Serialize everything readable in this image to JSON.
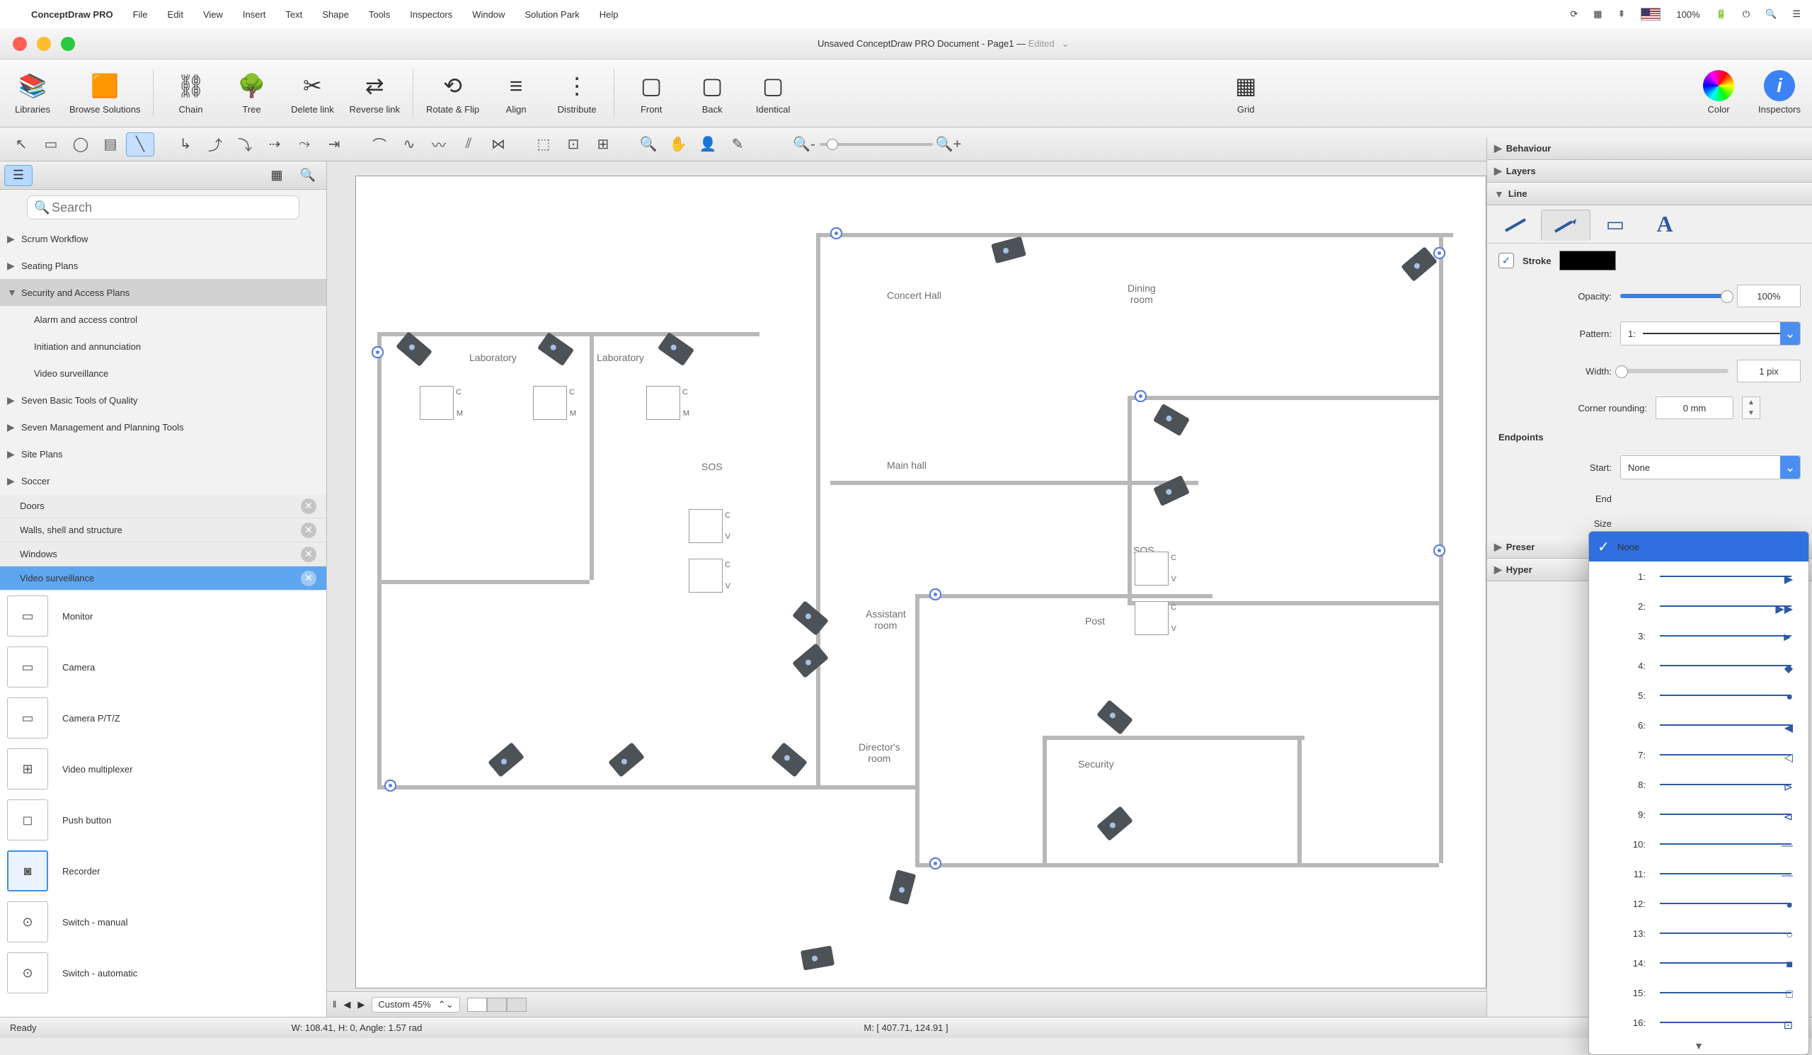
{
  "mac": {
    "app": "ConceptDraw PRO",
    "menu": [
      "File",
      "Edit",
      "View",
      "Insert",
      "Text",
      "Shape",
      "Tools",
      "Inspectors",
      "Window",
      "Solution Park",
      "Help"
    ],
    "battery": "100%"
  },
  "title": {
    "doc": "Unsaved ConceptDraw PRO Document - Page1",
    "edited": "Edited"
  },
  "toolbar": {
    "libraries": "Libraries",
    "browse": "Browse Solutions",
    "chain": "Chain",
    "tree": "Tree",
    "delete_link": "Delete link",
    "reverse_link": "Reverse link",
    "rotate": "Rotate & Flip",
    "align": "Align",
    "distribute": "Distribute",
    "front": "Front",
    "back": "Back",
    "identical": "Identical",
    "grid": "Grid",
    "color": "Color",
    "inspectors": "Inspectors"
  },
  "left": {
    "search_placeholder": "Search",
    "tree": [
      {
        "t": "Scrum Workflow",
        "exp": false
      },
      {
        "t": "Seating Plans",
        "exp": false
      },
      {
        "t": "Security and Access Plans",
        "exp": true,
        "sel": true
      },
      {
        "t": "Alarm and access control",
        "sub": true
      },
      {
        "t": "Initiation and annunciation",
        "sub": true
      },
      {
        "t": "Video surveillance",
        "sub": true
      },
      {
        "t": "Seven Basic Tools of Quality",
        "exp": false
      },
      {
        "t": "Seven Management and Planning Tools",
        "exp": false
      },
      {
        "t": "Site Plans",
        "exp": false
      },
      {
        "t": "Soccer",
        "exp": false
      }
    ],
    "libs": [
      {
        "t": "Doors"
      },
      {
        "t": "Walls, shell and structure"
      },
      {
        "t": "Windows"
      },
      {
        "t": "Video surveillance",
        "sel": true
      }
    ],
    "stencils": [
      {
        "t": "Monitor",
        "ico": "▭"
      },
      {
        "t": "Camera",
        "ico": "▭"
      },
      {
        "t": "Camera P/T/Z",
        "ico": "▭"
      },
      {
        "t": "Video multiplexer",
        "ico": "⊞"
      },
      {
        "t": "Push button",
        "ico": "◻"
      },
      {
        "t": "Recorder",
        "ico": "◙",
        "sel": true
      },
      {
        "t": "Switch - manual",
        "ico": "⊙"
      },
      {
        "t": "Switch - automatic",
        "ico": "⊙"
      }
    ]
  },
  "canvas": {
    "labels": {
      "concert_hall": "Concert Hall",
      "dining": "Dining\nroom",
      "laboratory1": "Laboratory",
      "laboratory2": "Laboratory",
      "main_hall": "Main hall",
      "assistant": "Assistant\nroom",
      "post": "Post",
      "director": "Director's\nroom",
      "security": "Security",
      "sos1": "SOS",
      "sos2": "SOS"
    },
    "footer": {
      "zoom": "Custom 45%"
    }
  },
  "inspector": {
    "behaviour": "Behaviour",
    "layers": "Layers",
    "line": "Line",
    "stroke_label": "Stroke",
    "opacity_label": "Opacity:",
    "opacity_val": "100%",
    "pattern_label": "Pattern:",
    "pattern_val": "1:",
    "width_label": "Width:",
    "width_val": "1 pix",
    "corner_label": "Corner rounding:",
    "corner_val": "0 mm",
    "endpoints": "Endpoints",
    "start_label": "Start:",
    "start_val": "None",
    "end_label": "End",
    "size_label": "Size",
    "presentation": "Preser",
    "hypernote": "Hyper"
  },
  "dropdown": {
    "none": "None",
    "items": [
      "1:",
      "2:",
      "3:",
      "4:",
      "5:",
      "6:",
      "7:",
      "8:",
      "9:",
      "10:",
      "11:",
      "12:",
      "13:",
      "14:",
      "15:",
      "16:"
    ]
  },
  "status": {
    "ready": "Ready",
    "dims": "W: 108.41,  H: 0,  Angle: 1.57 rad",
    "mouse": "M: [ 407.71, 124.91 ]"
  }
}
